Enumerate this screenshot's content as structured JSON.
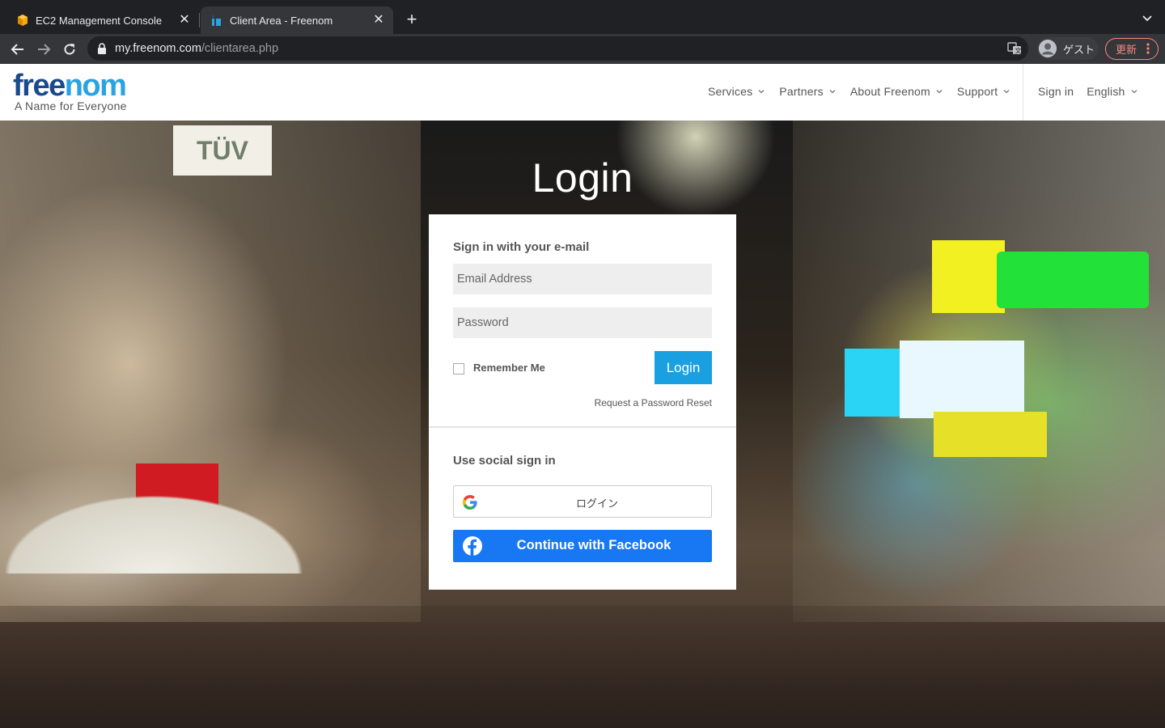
{
  "browser": {
    "tabs": [
      {
        "title": "EC2 Management Console",
        "favicon": "aws-cube-icon",
        "active": false
      },
      {
        "title": "Client Area - Freenom",
        "favicon": "freenom-icon",
        "active": true
      }
    ],
    "url": {
      "host": "my.freenom.com",
      "path": "/clientarea.php"
    },
    "profile_label": "ゲスト",
    "update_label": "更新"
  },
  "header": {
    "logo": {
      "word_part1": "free",
      "word_part2": "nom",
      "tagline": "A Name for Everyone"
    },
    "nav": [
      {
        "label": "Services"
      },
      {
        "label": "Partners"
      },
      {
        "label": "About Freenom"
      },
      {
        "label": "Support"
      }
    ],
    "sign_in": "Sign in",
    "language": "English"
  },
  "hero": {
    "title": "Login",
    "sign_tuv": "TÜV"
  },
  "login": {
    "email_section_title": "Sign in with your e-mail",
    "email_placeholder": "Email Address",
    "password_placeholder": "Password",
    "remember_label": "Remember Me",
    "login_button": "Login",
    "reset_link": "Request a Password Reset",
    "social_section_title": "Use social sign in",
    "google_button": "ログイン",
    "facebook_button": "Continue with Facebook"
  },
  "colors": {
    "brand_dark": "#1b4a8c",
    "brand_light": "#2aa3e2",
    "login_button": "#1a9fe0",
    "facebook": "#1877f2"
  }
}
